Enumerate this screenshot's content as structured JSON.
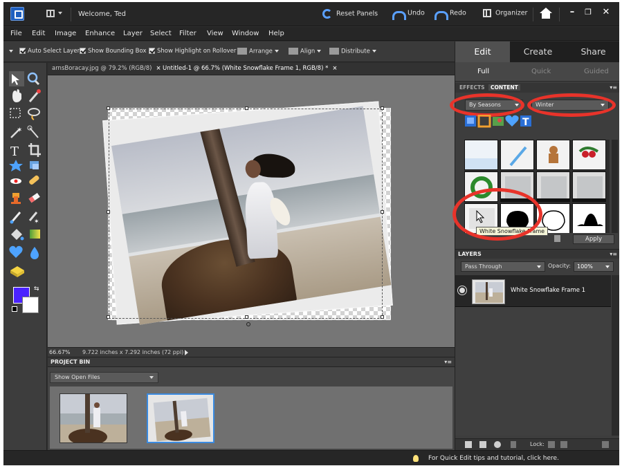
{
  "titlebar": {
    "welcome": "Welcome, Ted",
    "reset_panels": "Reset Panels",
    "undo": "Undo",
    "redo": "Redo",
    "organizer": "Organizer"
  },
  "menu": [
    "File",
    "Edit",
    "Image",
    "Enhance",
    "Layer",
    "Select",
    "Filter",
    "View",
    "Window",
    "Help"
  ],
  "options": {
    "auto_select_layer": "Auto Select Layer",
    "show_bounding_box": "Show Bounding Box",
    "show_highlight": "Show Highlight on Rollover",
    "arrange": "Arrange",
    "align": "Align",
    "distribute": "Distribute"
  },
  "doc_tabs": [
    {
      "label": "arnsBoracay.jpg @ 79.2% (RGB/8)"
    },
    {
      "label": "Untitled-1 @ 66.7% (White Snowflake Frame 1, RGB/8) *"
    }
  ],
  "canvas_status": {
    "zoom": "66.67%",
    "doc_size": "9.722 inches x 7.292 inches (72 ppi)"
  },
  "project_bin": {
    "title": "PROJECT BIN",
    "show": "Show Open Files"
  },
  "right_panel": {
    "modes": [
      "Edit",
      "Create",
      "Share"
    ],
    "sub_modes": [
      "Full",
      "Quick",
      "Guided"
    ],
    "panel_tabs": [
      "EFFECTS",
      "CONTENT"
    ],
    "filter_by": "By Seasons",
    "filter_value": "Winter",
    "tooltip": "White Snowflake Frame",
    "apply": "Apply"
  },
  "layers": {
    "title": "LAYERS",
    "blend_mode": "Pass Through",
    "opacity_label": "Opacity:",
    "opacity_value": "100%",
    "layer_name": "White Snowflake Frame 1",
    "lock_label": "Lock:"
  },
  "status": {
    "tip": "For Quick Edit tips and tutorial, click here."
  },
  "colors": {
    "foreground": "#4a22ff",
    "background": "#ffffff",
    "annotation": "#e8332a",
    "accent": "#3a8ae0"
  }
}
